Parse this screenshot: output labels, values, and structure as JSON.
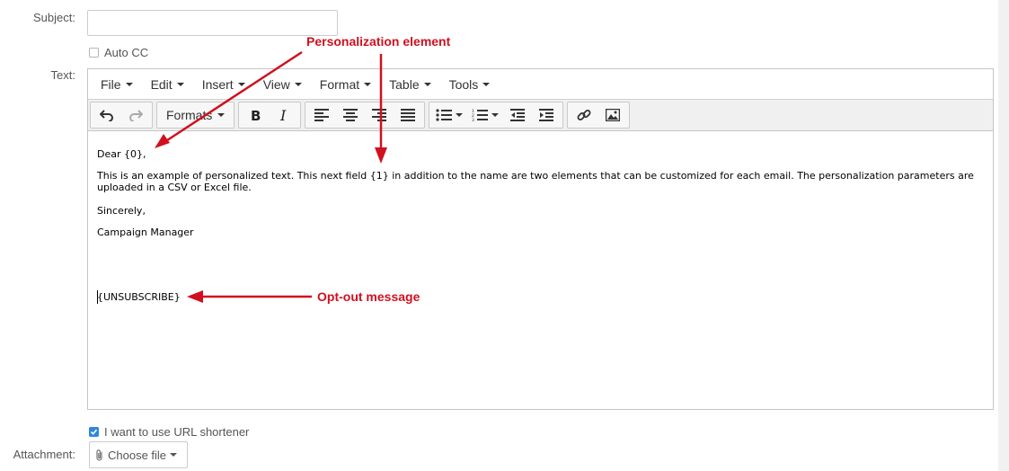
{
  "form": {
    "subject_label": "Subject:",
    "subject_value": "",
    "auto_cc_label": "Auto CC",
    "auto_cc_checked": false,
    "text_label": "Text:",
    "url_shortener_label": "I want to use URL shortener",
    "url_shortener_checked": true,
    "attachment_label": "Attachment:",
    "choose_file_label": "Choose file"
  },
  "editor": {
    "menu": [
      "File",
      "Edit",
      "Insert",
      "View",
      "Format",
      "Table",
      "Tools"
    ],
    "formats_label": "Formats",
    "toolbar_icons": [
      "undo-icon",
      "redo-icon",
      "bold-icon",
      "italic-icon",
      "align-left-icon",
      "align-center-icon",
      "align-right-icon",
      "align-justify-icon",
      "bullet-list-icon",
      "numbered-list-icon",
      "outdent-icon",
      "indent-icon",
      "link-icon",
      "image-icon"
    ],
    "content": {
      "greeting": "Dear {0},",
      "body": "This is an example of personalized text. This next field {1} in addition to the name are two elements that can be customized for each email. The personalization parameters are uploaded in a CSV or Excel file.",
      "closing": "Sincerely,",
      "signature": "Campaign Manager",
      "unsubscribe": "{UNSUBSCRIBE}"
    }
  },
  "annotations": {
    "personalization": "Personalization element",
    "opt_out": "Opt-out message",
    "color": "#d0101f"
  }
}
